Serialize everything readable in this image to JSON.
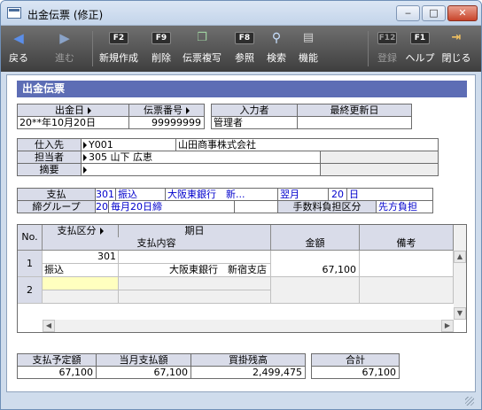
{
  "window": {
    "title": "出金伝票 (修正)"
  },
  "toolbar": {
    "back": "戻る",
    "forward": "進む",
    "f2_key": "F2",
    "new": "新規作成",
    "f9_key": "F9",
    "delete": "削除",
    "copy": "伝票複写",
    "f8_key": "F8",
    "reference": "参照",
    "search": "検索",
    "function": "機能",
    "f12_key": "F12",
    "register": "登録",
    "f1_key": "F1",
    "help": "ヘルプ",
    "close": "閉じる"
  },
  "form": {
    "heading": "出金伝票",
    "date_label": "出金日",
    "date_value": "20**年10月20日",
    "slip_no_label": "伝票番号",
    "slip_no_value": "99999999",
    "entered_by_label": "入力者",
    "entered_by_value": "管理者",
    "updated_label": "最終更新日",
    "updated_value": "",
    "vendor_label": "仕入先",
    "vendor_code": "Y001",
    "vendor_name": "山田商事株式会社",
    "staff_label": "担当者",
    "staff_code": "305",
    "staff_name": "山下 広恵",
    "summary_label": "摘要",
    "pay_label": "支払",
    "pay_code": "301",
    "pay_method": "振込",
    "pay_bank": "大阪東銀行　新...",
    "pay_month": "翌月",
    "pay_day": "20",
    "pay_day_unit": "日",
    "close_group_label": "締グループ",
    "close_group_code": "20",
    "close_group_value": "毎月20日締",
    "fee_label": "手数料負担区分",
    "fee_value": "先方負担"
  },
  "grid": {
    "no_header": "No.",
    "pay_type_header": "支払区分",
    "due_date_header": "期日",
    "pay_detail_header": "支払内容",
    "amount_header": "金額",
    "note_header": "備考",
    "rows": [
      {
        "no": "1",
        "code": "301",
        "type": "振込",
        "detail": "大阪東銀行　新宿支店",
        "amount": "67,100",
        "note": ""
      },
      {
        "no": "2",
        "code": "",
        "type": "",
        "detail": "",
        "amount": "",
        "note": ""
      }
    ]
  },
  "totals": {
    "scheduled_label": "支払予定額",
    "scheduled_value": "67,100",
    "month_label": "当月支払額",
    "month_value": "67,100",
    "balance_label": "買掛残高",
    "balance_value": "2,499,475",
    "total_label": "合計",
    "total_value": "67,100"
  },
  "colors": {
    "accent": "#5d6db5",
    "label_bg": "#d9dce9",
    "value_blue": "#0000cc",
    "selected_cell": "#ffffbf"
  }
}
